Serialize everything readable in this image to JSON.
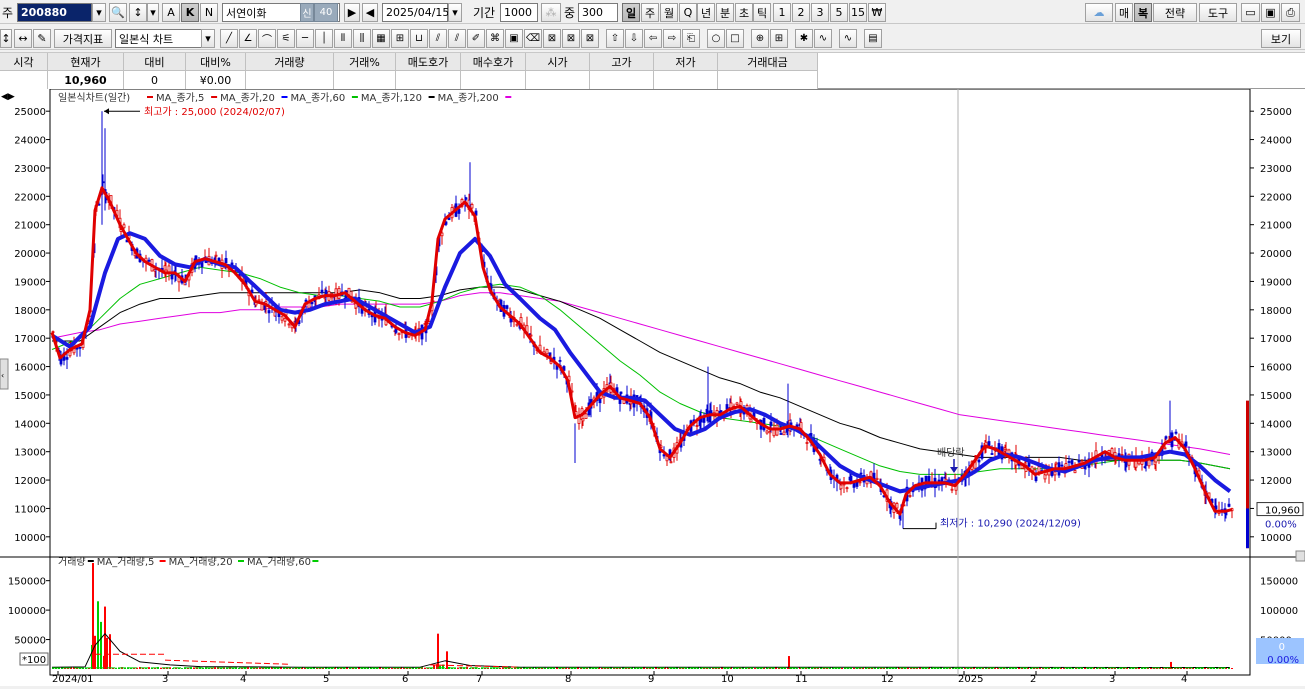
{
  "toolbar1": {
    "market_label": "주",
    "stock_code": "200880",
    "search_glyph": "🔍",
    "sort_glyph": "↕",
    "mode_a": "A",
    "mode_k": "K",
    "mode_n": "N",
    "stock_name": "서연이화",
    "credit_badge": "신",
    "margin_badge": "40",
    "date": "2025/04/15",
    "period_label": "기간",
    "period_value": "1000",
    "count_label": "중",
    "count_value": "300",
    "periods": [
      "일",
      "주",
      "월",
      "Q",
      "년",
      "분",
      "초",
      "틱",
      "1",
      "2",
      "3",
      "5",
      "15",
      "₩"
    ],
    "right_buttons": [
      "매",
      "복",
      "전략",
      "도구"
    ]
  },
  "toolbar2": {
    "indicator_button": "가격지표",
    "chart_type": "일본식 차트",
    "view_button": "보기"
  },
  "quote": {
    "headers": [
      "시각",
      "현재가",
      "대비",
      "대비%",
      "거래량",
      "거래%",
      "매도호가",
      "매수호가",
      "시가",
      "고가",
      "저가",
      "거래대금"
    ],
    "values": [
      "",
      "10,960",
      "0",
      "0.00",
      "",
      "",
      "",
      "",
      "",
      "",
      "",
      ""
    ]
  },
  "price_chart": {
    "legend_title": "일본식차트(일간)",
    "legend": [
      {
        "name": "MA_종가,5",
        "color": "#e00000"
      },
      {
        "name": "MA_종가,20",
        "color": "#e00000"
      },
      {
        "name": "MA_종가,60",
        "color": "#0000ff"
      },
      {
        "name": "MA_종가,120",
        "color": "#00c000"
      },
      {
        "name": "MA_종가,200",
        "color": "#000000"
      },
      {
        "name": "",
        "color": "#e000e0"
      }
    ],
    "high_annotation": "최고가 : 25,000 (2024/02/07)",
    "low_annotation": "최저가 : 10,290 (2024/12/09)",
    "dividend_label": "배당락",
    "current_price": "10,960",
    "current_pct": "0.00%",
    "y_ticks": [
      "25000",
      "24000",
      "23000",
      "22000",
      "21000",
      "20000",
      "19000",
      "18000",
      "17000",
      "16000",
      "15000",
      "14000",
      "13000",
      "12000",
      "11000",
      "10000"
    ]
  },
  "volume_chart": {
    "legend": [
      {
        "name": "거래량",
        "color": "#ff0000"
      },
      {
        "name": "MA_거래량,5",
        "color": "#000000"
      },
      {
        "name": "MA_거래량,20",
        "color": "#ff0000"
      },
      {
        "name": "MA_거래량,60",
        "color": "#00cc00"
      }
    ],
    "y_ticks": [
      "150000",
      "100000",
      "50000"
    ],
    "unit": "*100",
    "current_volume": "0",
    "current_pct": "0.00%"
  },
  "x_axis": [
    "2024/01",
    "3",
    "4",
    "5",
    "6",
    "7",
    "8",
    "9",
    "10",
    "11",
    "12",
    "2025",
    "2",
    "3",
    "4"
  ],
  "chart_data": {
    "type": "line",
    "title": "",
    "x": [
      "2024-01",
      "2024-02",
      "2024-03",
      "2024-04",
      "2024-05",
      "2024-06",
      "2024-07",
      "2024-08",
      "2024-09",
      "2024-10",
      "2024-11",
      "2024-12",
      "2025-01",
      "2025-02",
      "2025-03",
      "2025-04"
    ],
    "series": [
      {
        "name": "MA_종가,5",
        "values": [
          16800,
          21500,
          19500,
          19200,
          18300,
          17200,
          21500,
          17200,
          15000,
          14500,
          13800,
          11800,
          12300,
          12300,
          12700,
          10950
        ]
      },
      {
        "name": "MA_종가,20",
        "values": [
          17000,
          19800,
          20500,
          19300,
          18200,
          17400,
          20300,
          18000,
          15000,
          14200,
          13800,
          12000,
          12800,
          12200,
          12700,
          11700
        ]
      },
      {
        "name": "MA_종가,60",
        "values": [
          17200,
          18800,
          19300,
          19400,
          18700,
          18000,
          18600,
          18700,
          17000,
          14700,
          13200,
          12800,
          12100,
          12100,
          12400,
          12350
        ]
      },
      {
        "name": "MA_종가,120",
        "values": [
          16800,
          17500,
          18100,
          18300,
          18300,
          18400,
          18600,
          18900,
          17600,
          15900,
          14500,
          13800,
          13000,
          12800,
          12700,
          12800
        ]
      },
      {
        "name": "",
        "values": [
          17200,
          17500,
          17800,
          18000,
          18000,
          18100,
          18300,
          18600,
          17900,
          16700,
          15800,
          14600,
          14000,
          13600,
          13300,
          12900
        ]
      }
    ],
    "ylim": [
      9500,
      25500
    ],
    "volume": {
      "ylim": [
        0,
        180000
      ],
      "peak": 180000
    }
  }
}
